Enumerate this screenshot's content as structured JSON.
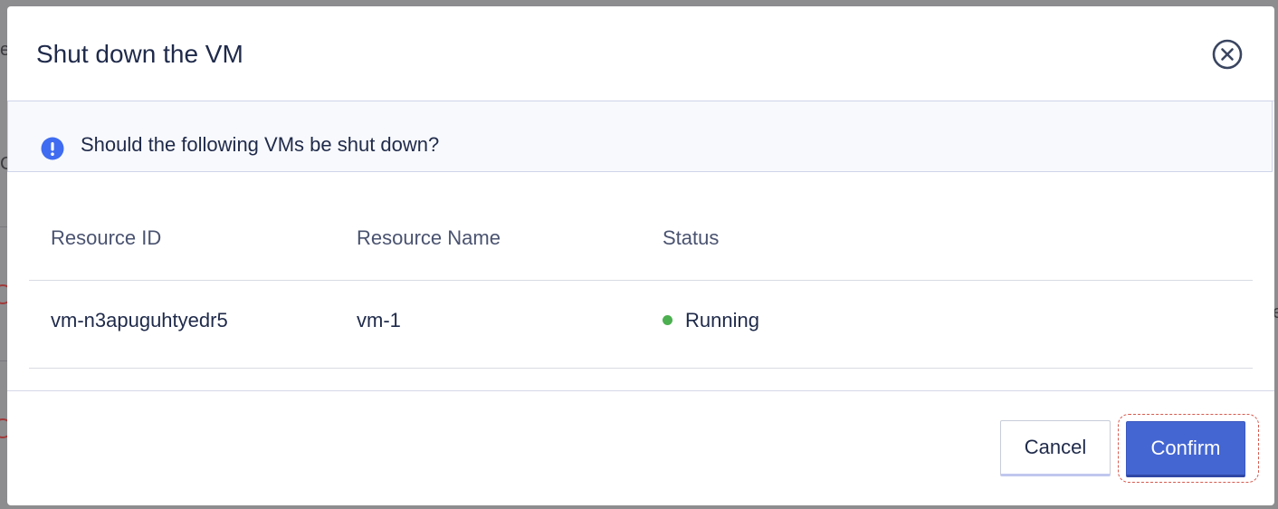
{
  "dialog": {
    "title": "Shut down the VM",
    "close_icon": "close-circle-icon"
  },
  "notice": {
    "icon": "info-exclamation-icon",
    "text": "Should the following VMs be shut down?",
    "icon_color": "#3f6cf0"
  },
  "table": {
    "headers": [
      "Resource ID",
      "Resource Name",
      "Status"
    ],
    "rows": [
      {
        "resource_id": "vm-n3apuguhtyedr5",
        "resource_name": "vm-1",
        "status": "Running",
        "status_color": "#4caf50"
      }
    ]
  },
  "footer": {
    "cancel_label": "Cancel",
    "confirm_label": "Confirm",
    "confirm_color": "#4466d2"
  }
}
